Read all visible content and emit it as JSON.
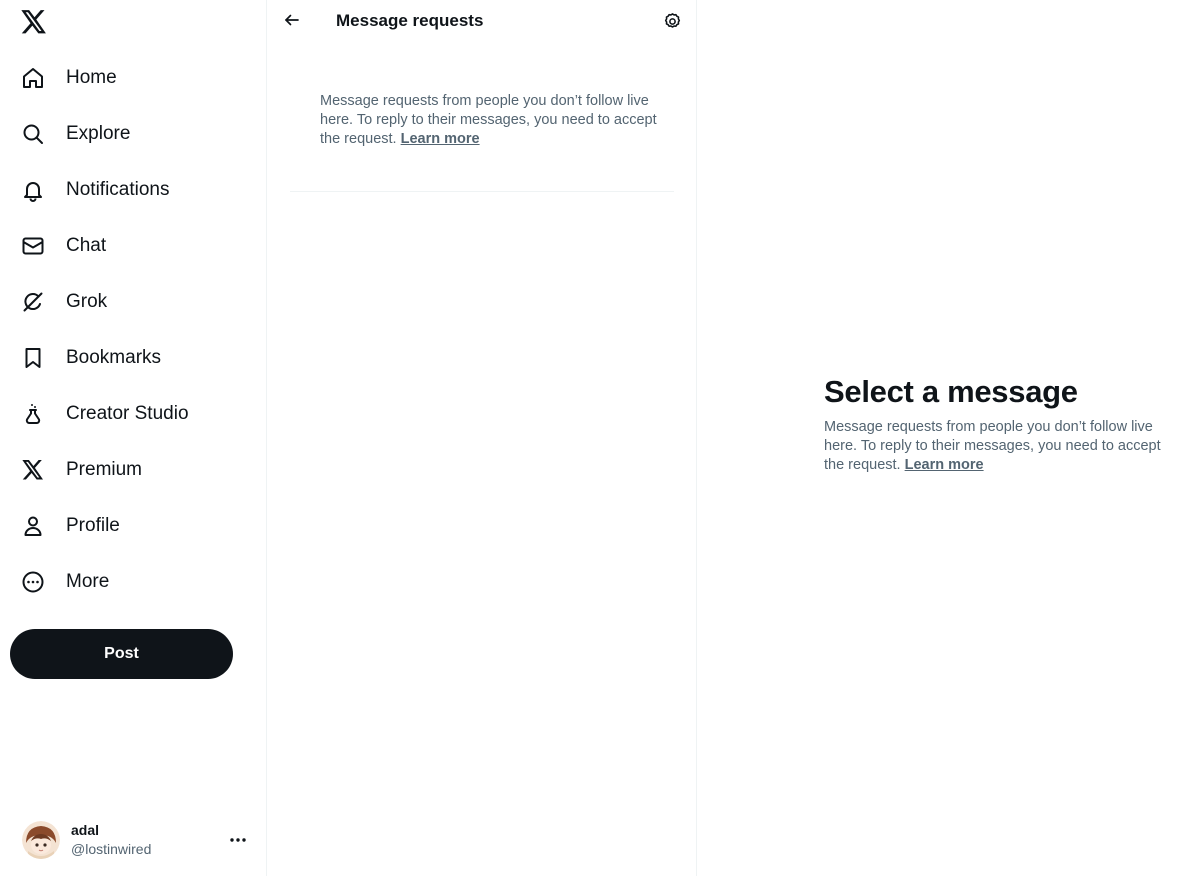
{
  "sidebar": {
    "logo_icon": "x-logo-icon",
    "nav": [
      {
        "label": "Home",
        "icon": "home-icon"
      },
      {
        "label": "Explore",
        "icon": "search-icon"
      },
      {
        "label": "Notifications",
        "icon": "bell-icon"
      },
      {
        "label": "Chat",
        "icon": "mail-icon"
      },
      {
        "label": "Grok",
        "icon": "grok-icon"
      },
      {
        "label": "Bookmarks",
        "icon": "bookmark-icon"
      },
      {
        "label": "Creator Studio",
        "icon": "flask-icon"
      },
      {
        "label": "Premium",
        "icon": "x-logo-icon"
      },
      {
        "label": "Profile",
        "icon": "person-icon"
      },
      {
        "label": "More",
        "icon": "more-circle-icon"
      }
    ],
    "post_label": "Post",
    "account": {
      "name": "adal",
      "handle": "@lostinwired",
      "more_icon": "ellipsis-icon"
    }
  },
  "middle": {
    "title": "Message requests",
    "back_icon": "arrow-left-icon",
    "settings_icon": "gear-icon",
    "info_text": "Message requests from people you don’t follow live here. To reply to their messages, you need to accept the request.",
    "learn_more": "Learn more"
  },
  "right": {
    "title": "Select a message",
    "text": "Message requests from people you don’t follow live here. To reply to their messages, you need to accept the request.",
    "learn_more": "Learn more"
  },
  "colors": {
    "text_primary": "#0f1419",
    "text_secondary": "#536471",
    "divider": "#eff3f4",
    "post_button_bg": "#0f1419",
    "post_button_text": "#ffffff"
  }
}
